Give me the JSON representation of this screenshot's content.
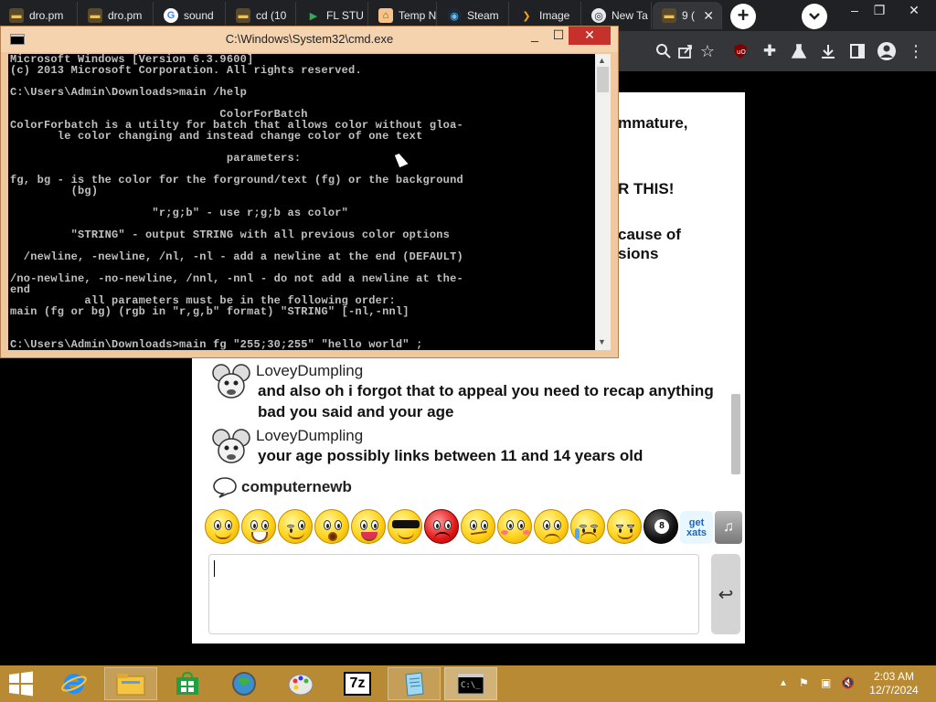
{
  "browser": {
    "tabs": [
      {
        "label": "dro.pm",
        "icon": "folder-icon"
      },
      {
        "label": "dro.pm",
        "icon": "folder-icon"
      },
      {
        "label": "sound",
        "icon": "google-icon"
      },
      {
        "label": "cd (10",
        "icon": "folder-icon"
      },
      {
        "label": "FL STU",
        "icon": "play-store-icon"
      },
      {
        "label": "Temp N",
        "icon": "house-icon"
      },
      {
        "label": "Steam",
        "icon": "steam-icon"
      },
      {
        "label": "Image",
        "icon": "image-icon"
      },
      {
        "label": "New Ta",
        "icon": "chrome-icon"
      },
      {
        "label": "9 (",
        "icon": "folder-icon",
        "active": true
      }
    ],
    "new_tab_label": "+",
    "window_controls": {
      "minimize": "–",
      "restore": "❐",
      "close": "✕"
    }
  },
  "chat": {
    "background_lines": [
      "mmature,",
      "R THIS!",
      "cause of",
      "sions"
    ],
    "messages": [
      {
        "user": "LoveyDumpling",
        "text": "and also oh i forgot that to appeal you need to recap anything bad you said and your age"
      },
      {
        "user": "LoveyDumpling",
        "text": "your age possibly links between 11 and 14 years old"
      }
    ],
    "typing_user": "computernewb",
    "send_glyph": "↩",
    "sticker_labels": [
      "get xats"
    ]
  },
  "cmd": {
    "title": "C:\\Windows\\System32\\cmd.exe",
    "controls": {
      "minimize": "_",
      "maximize": "☐",
      "close": "✕"
    },
    "output": "Microsoft Windows [Version 6.3.9600]\n(c) 2013 Microsoft Corporation. All rights reserved.\n\nC:\\Users\\Admin\\Downloads>main /help\n\n                               ColorForBatch\nColorForbatch is a utilty for batch that allows color without gloa-\n       le color changing and instead change color of one text\n\n                                parameters:\n\nfg, bg - is the color for the forground/text (fg) or the background\n         (bg)\n\n                     \"r;g;b\" - use r;g;b as color\"\n\n         \"STRING\" - output STRING with all previous color options\n\n  /newline, -newline, /nl, -nl - add a newline at the end (DEFAULT)\n\n/no-newline, -no-newline, /nnl, -nnl - do not add a newline at the-\nend\n           all parameters must be in the following order:\nmain (fg or bg) (rgb in \"r,g,b\" format) \"STRING\" [-nl,-nnl]\n\n\nC:\\Users\\Admin\\Downloads>main fg \"255;30;255\" \"hello world\" ;"
  },
  "taskbar": {
    "apps": [
      "ie-icon",
      "file-explorer-icon",
      "store-icon",
      "network-globe-icon",
      "paint-icon",
      "7zip-icon",
      "notepad-icon",
      "cmd-icon"
    ],
    "seven_zip_label": "7z",
    "clock_time": "2:03 AM",
    "clock_date": "12/7/2024"
  }
}
